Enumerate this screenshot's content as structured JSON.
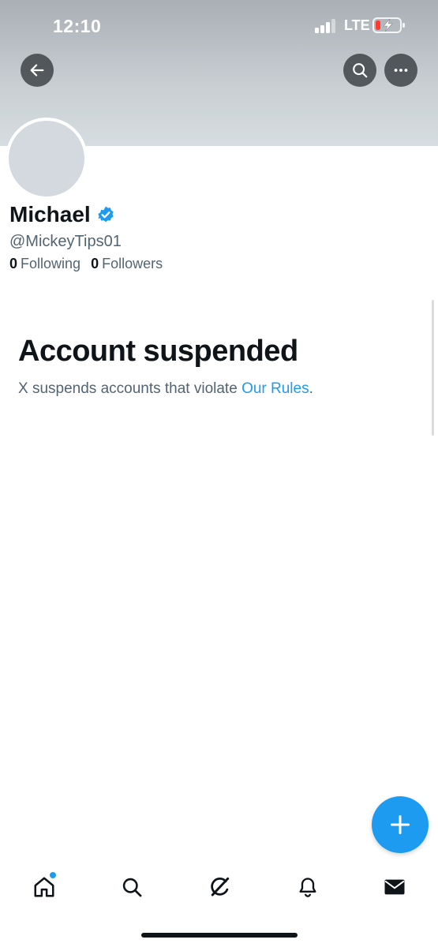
{
  "status_bar": {
    "time": "12:10",
    "network": "LTE",
    "battery_level": 0.15,
    "battery_color": "#ff3b30"
  },
  "header": {
    "back_icon": "arrow-left-icon",
    "search_icon": "search-icon",
    "more_icon": "more-horizontal-icon"
  },
  "profile": {
    "name": "Michael",
    "handle": "@MickeyTips01",
    "following_count": "0",
    "following_label": "Following",
    "followers_count": "0",
    "followers_label": "Followers",
    "verified_color": "#1d9bf0"
  },
  "suspension": {
    "title": "Account suspended",
    "text_before": "X suspends accounts that violate ",
    "link_text": "Our Rules",
    "text_after": "."
  },
  "tab_bar": {
    "items": [
      "home-icon",
      "search-icon",
      "grok-icon",
      "notifications-bell-icon",
      "messages-icon"
    ],
    "home_has_notification_dot": true,
    "accent_color": "#1d9bf0"
  },
  "fab": {
    "icon": "plus-icon"
  }
}
